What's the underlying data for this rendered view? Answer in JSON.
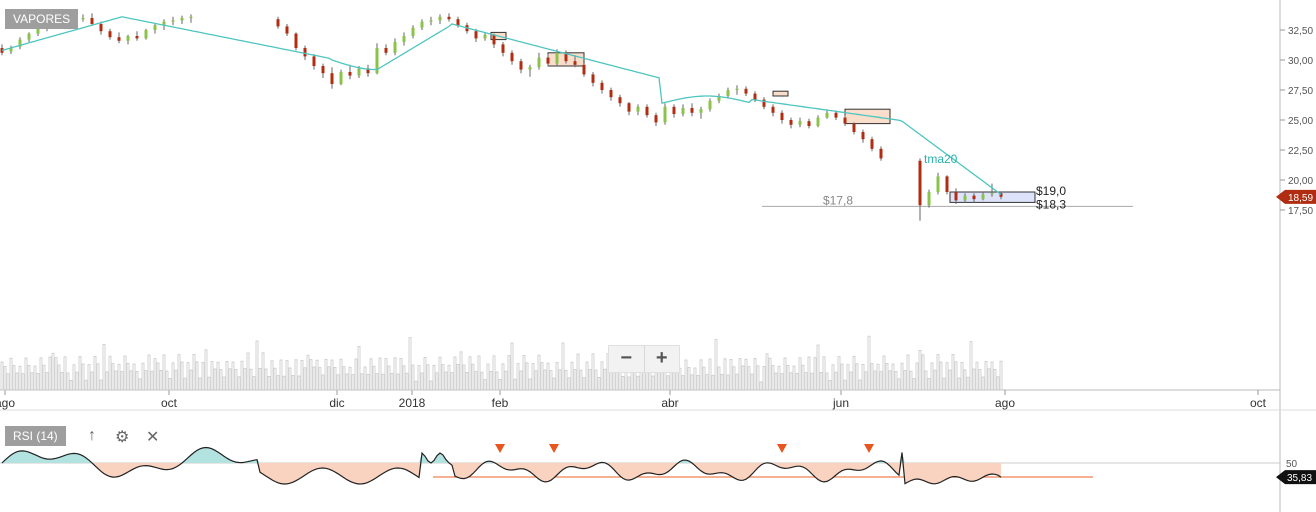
{
  "chart_data": [
    {
      "type": "candlestick",
      "title": "VAPORES",
      "x_tick_labels": [
        "ago",
        "oct",
        "dic",
        "2018",
        "feb",
        "abr",
        "jun",
        "ago",
        "oct"
      ],
      "y_tick_labels": [
        "32,50",
        "30,00",
        "27,50",
        "25,00",
        "22,50",
        "20,00",
        "17,50"
      ],
      "ylim": [
        15.5,
        33.5
      ],
      "current_price_label": "18,59",
      "current_price": 18.59,
      "series": [
        {
          "name": "tma20"
        }
      ],
      "annotations": [
        {
          "text": "$19,0",
          "value": 19.0
        },
        {
          "text": "$18,3",
          "value": 18.3
        },
        {
          "text": "$17,8",
          "value": 17.8
        }
      ],
      "ohlc": [
        [
          0,
          31.0,
          31.3,
          30.4,
          30.6
        ],
        [
          3,
          30.7,
          31.2,
          30.5,
          31.0
        ],
        [
          6,
          31.1,
          31.9,
          30.9,
          31.7
        ],
        [
          9,
          31.7,
          32.3,
          31.5,
          32.2
        ],
        [
          12,
          32.2,
          32.8,
          32.0,
          32.6
        ],
        [
          15,
          32.6,
          33.2,
          32.4,
          33.1
        ],
        [
          18,
          33.1,
          33.5,
          32.8,
          32.9
        ],
        [
          21,
          32.9,
          33.3,
          32.6,
          33.2
        ],
        [
          24,
          33.2,
          33.6,
          33.0,
          33.4
        ],
        [
          27,
          33.4,
          33.8,
          33.2,
          33.5
        ],
        [
          30,
          33.5,
          33.9,
          32.9,
          33.0
        ],
        [
          33,
          33.0,
          33.2,
          32.1,
          32.4
        ],
        [
          36,
          32.4,
          32.6,
          31.7,
          31.9
        ],
        [
          39,
          31.9,
          32.3,
          31.4,
          31.6
        ],
        [
          42,
          31.6,
          32.1,
          31.3,
          32.0
        ],
        [
          45,
          32.0,
          32.4,
          31.6,
          31.8
        ],
        [
          48,
          31.8,
          32.6,
          31.7,
          32.5
        ],
        [
          51,
          32.5,
          33.0,
          32.2,
          32.9
        ],
        [
          54,
          32.9,
          33.4,
          32.5,
          33.2
        ],
        [
          57,
          33.2,
          33.6,
          32.9,
          33.3
        ],
        [
          60,
          33.3,
          33.7,
          33.0,
          33.5
        ],
        [
          63,
          33.5,
          33.8,
          33.1,
          33.6
        ],
        [
          92,
          33.4,
          33.6,
          32.6,
          32.8
        ],
        [
          95,
          32.8,
          33.0,
          32.0,
          32.2
        ],
        [
          98,
          32.2,
          32.3,
          30.8,
          31.0
        ],
        [
          101,
          31.0,
          31.2,
          30.0,
          30.3
        ],
        [
          104,
          30.3,
          30.5,
          29.2,
          29.5
        ],
        [
          107,
          29.5,
          29.7,
          28.5,
          28.9
        ],
        [
          110,
          28.9,
          29.4,
          27.6,
          28.0
        ],
        [
          113,
          28.0,
          29.2,
          27.9,
          29.0
        ],
        [
          116,
          29.0,
          29.6,
          28.4,
          28.7
        ],
        [
          119,
          28.7,
          29.5,
          28.5,
          29.3
        ],
        [
          122,
          29.3,
          29.6,
          28.6,
          28.9
        ],
        [
          125,
          28.9,
          31.4,
          28.8,
          31.0
        ],
        [
          128,
          31.0,
          31.3,
          30.4,
          30.6
        ],
        [
          131,
          30.6,
          31.8,
          30.4,
          31.5
        ],
        [
          134,
          31.5,
          32.3,
          31.2,
          32.0
        ],
        [
          137,
          32.0,
          32.9,
          31.8,
          32.7
        ],
        [
          140,
          32.7,
          33.4,
          32.5,
          33.2
        ],
        [
          143,
          33.2,
          33.6,
          32.9,
          33.3
        ],
        [
          146,
          33.3,
          33.8,
          33.0,
          33.6
        ],
        [
          149,
          33.6,
          33.9,
          33.2,
          33.4
        ],
        [
          152,
          33.4,
          33.6,
          32.7,
          32.9
        ],
        [
          155,
          32.9,
          33.1,
          32.2,
          32.4
        ],
        [
          158,
          32.4,
          32.6,
          31.5,
          31.8
        ],
        [
          161,
          31.8,
          32.3,
          31.6,
          32.1
        ],
        [
          164,
          32.1,
          32.2,
          31.0,
          31.3
        ],
        [
          167,
          31.3,
          31.5,
          30.3,
          30.6
        ],
        [
          170,
          30.6,
          30.8,
          29.6,
          29.9
        ],
        [
          173,
          29.9,
          30.1,
          28.9,
          29.2
        ],
        [
          176,
          29.2,
          29.6,
          28.6,
          29.4
        ],
        [
          179,
          29.4,
          30.6,
          29.2,
          30.2
        ],
        [
          182,
          30.2,
          30.5,
          29.5,
          29.7
        ],
        [
          185,
          29.7,
          30.9,
          29.5,
          30.6
        ],
        [
          188,
          30.6,
          30.8,
          29.7,
          29.9
        ],
        [
          191,
          29.9,
          30.4,
          29.4,
          29.6
        ],
        [
          194,
          29.6,
          29.7,
          28.6,
          28.8
        ],
        [
          197,
          28.8,
          29.0,
          27.8,
          28.1
        ],
        [
          200,
          28.1,
          28.3,
          27.2,
          27.5
        ],
        [
          203,
          27.5,
          27.7,
          26.6,
          26.9
        ],
        [
          206,
          26.9,
          27.1,
          26.1,
          26.4
        ],
        [
          209,
          26.4,
          26.5,
          25.4,
          25.7
        ],
        [
          212,
          25.7,
          26.3,
          25.4,
          26.1
        ],
        [
          215,
          26.1,
          26.3,
          25.2,
          25.4
        ],
        [
          218,
          25.4,
          25.6,
          24.5,
          24.8
        ],
        [
          221,
          24.8,
          26.4,
          24.6,
          26.1
        ],
        [
          224,
          26.1,
          26.3,
          25.2,
          25.5
        ],
        [
          227,
          25.5,
          26.3,
          25.3,
          26.0
        ],
        [
          230,
          26.0,
          26.4,
          25.3,
          25.6
        ],
        [
          233,
          25.6,
          26.1,
          25.1,
          25.9
        ],
        [
          236,
          25.9,
          26.8,
          25.7,
          26.6
        ],
        [
          239,
          26.6,
          27.2,
          26.4,
          27.0
        ],
        [
          242,
          27.0,
          27.7,
          26.8,
          27.5
        ],
        [
          245,
          27.5,
          27.9,
          27.1,
          27.6
        ],
        [
          248,
          27.6,
          27.8,
          27.0,
          27.2
        ],
        [
          251,
          27.2,
          27.4,
          26.5,
          26.7
        ],
        [
          254,
          26.7,
          26.9,
          25.9,
          26.1
        ],
        [
          257,
          26.1,
          26.3,
          25.3,
          25.6
        ],
        [
          260,
          25.6,
          25.8,
          24.7,
          25.0
        ],
        [
          263,
          25.0,
          25.2,
          24.3,
          24.6
        ],
        [
          266,
          24.6,
          25.2,
          24.4,
          24.9
        ],
        [
          269,
          24.9,
          25.1,
          24.3,
          24.5
        ],
        [
          272,
          24.5,
          25.4,
          24.4,
          25.2
        ],
        [
          275,
          25.2,
          25.9,
          25.1,
          25.6
        ],
        [
          278,
          25.6,
          25.8,
          25.0,
          25.2
        ],
        [
          281,
          25.2,
          25.4,
          24.5,
          24.7
        ],
        [
          284,
          24.7,
          24.8,
          23.8,
          24.0
        ],
        [
          287,
          24.0,
          24.2,
          23.1,
          23.4
        ],
        [
          290,
          23.4,
          23.6,
          22.4,
          22.6
        ],
        [
          293,
          22.6,
          22.8,
          21.6,
          21.8
        ],
        [
          306,
          21.6,
          21.8,
          16.6,
          17.9
        ],
        [
          309,
          17.9,
          19.2,
          17.7,
          19.0
        ],
        [
          312,
          19.0,
          20.6,
          18.8,
          20.3
        ],
        [
          315,
          20.3,
          20.4,
          18.8,
          19.0
        ],
        [
          318,
          19.0,
          19.3,
          18.0,
          18.3
        ],
        [
          321,
          18.3,
          18.9,
          18.1,
          18.7
        ],
        [
          324,
          18.7,
          18.9,
          18.1,
          18.4
        ],
        [
          327,
          18.4,
          19.0,
          18.3,
          18.8
        ],
        [
          330,
          18.8,
          19.7,
          18.6,
          18.9
        ],
        [
          333,
          18.9,
          19.0,
          18.4,
          18.6
        ]
      ]
    },
    {
      "type": "line",
      "title": "RSI (14)",
      "y_tick_labels": [
        "50"
      ],
      "current_value_label": "35,83",
      "current_value": 35.83,
      "reference_level": 50,
      "support_level": 36
    }
  ],
  "ui": {
    "zoom_out_label": "−",
    "zoom_in_label": "+",
    "up_icon": "↑",
    "gear_icon": "⚙",
    "close_icon": "✕"
  }
}
